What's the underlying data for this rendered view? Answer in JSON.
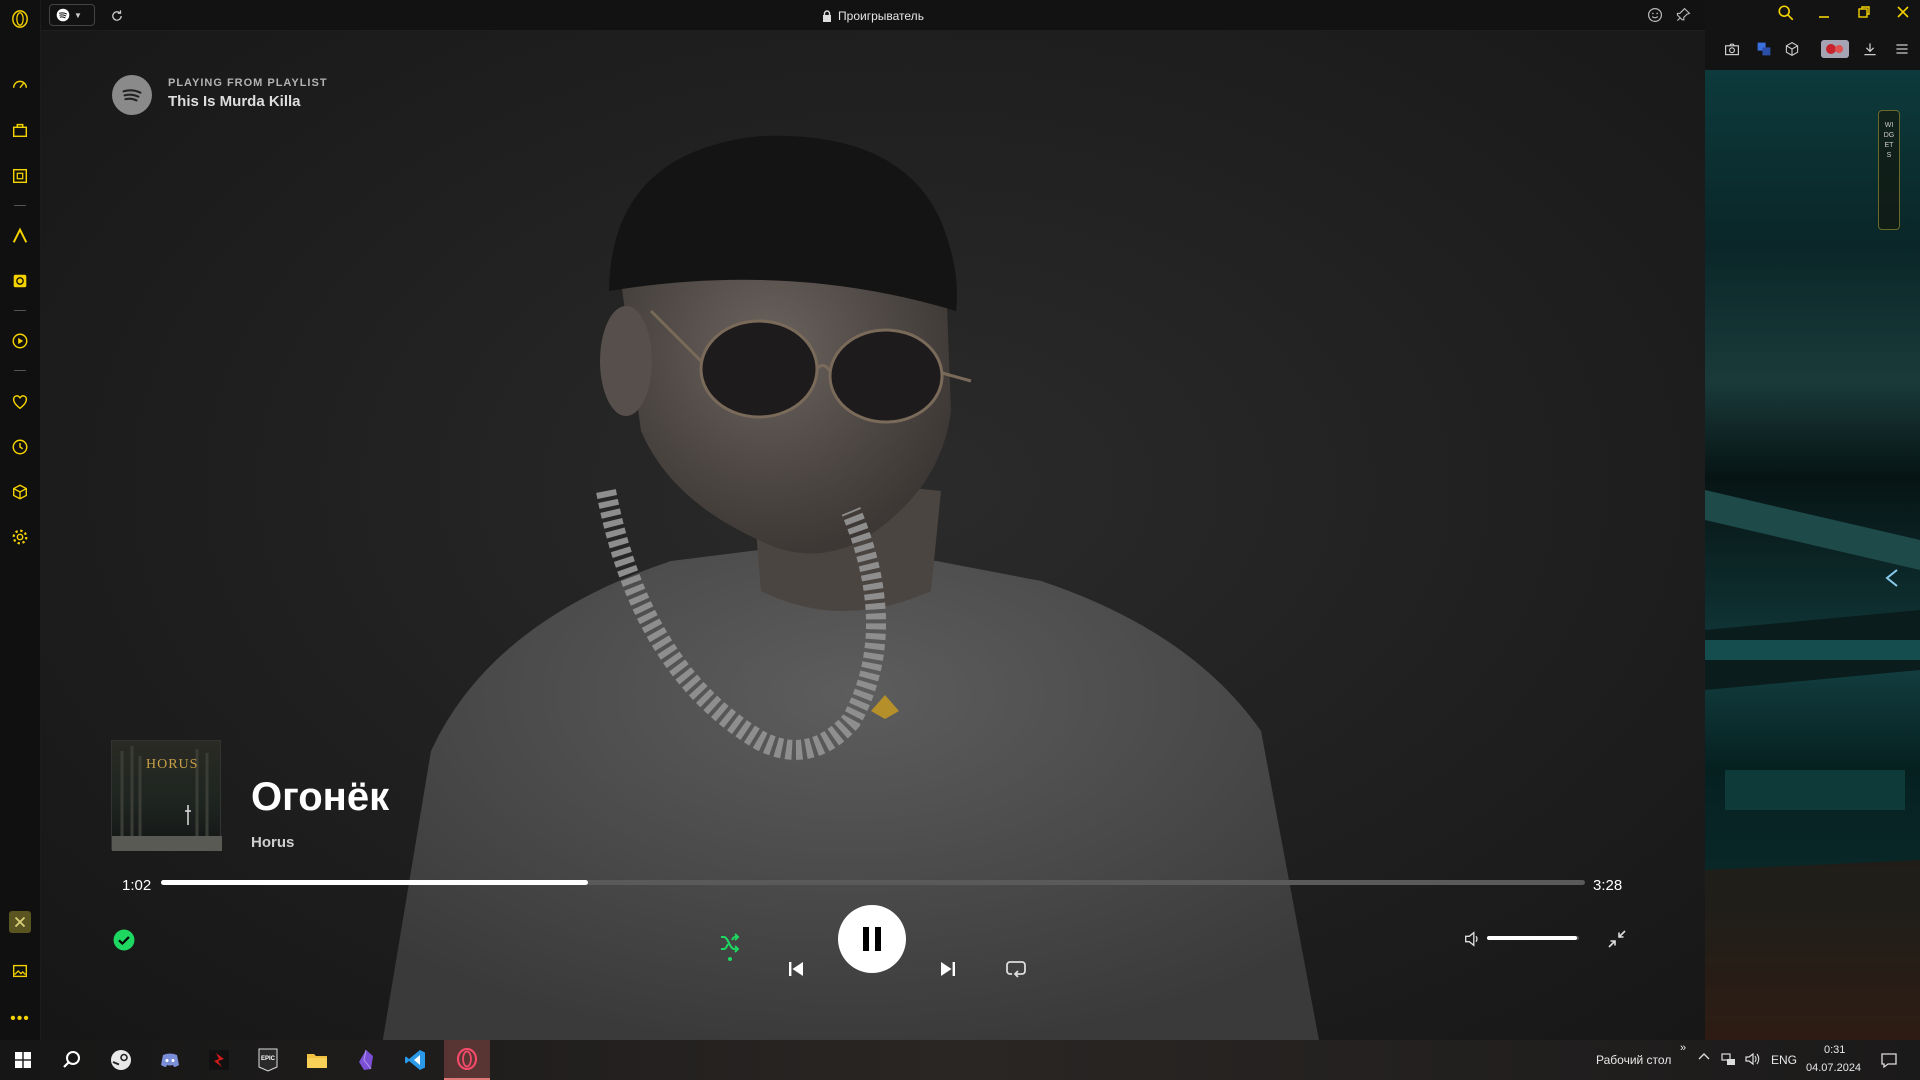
{
  "window": {
    "address_title": "Проигрыватель",
    "tab_icon": "spotify-icon"
  },
  "header": {
    "label": "PLAYING FROM PLAYLIST",
    "playlist": "This Is Murda Killa"
  },
  "track": {
    "title": "Огонёк",
    "artist": "Horus",
    "album_art_text": "HORUS",
    "current_time": "1:02",
    "duration": "3:28",
    "progress": 0.3,
    "liked": true,
    "shuffle_active": true,
    "is_playing": true
  },
  "volume": {
    "level": 0.98
  },
  "sidebar": {
    "items": [
      "speed-dial-icon",
      "bag-icon",
      "workspace-icon",
      "aria-icon",
      "widget-icon",
      "player-icon",
      "heart-icon",
      "history-icon",
      "box-icon",
      "settings-icon",
      "game-icon",
      "gallery-icon",
      "more-icon"
    ]
  },
  "right_panel": {
    "widgets_label": "WIDGETS"
  },
  "taskbar": {
    "apps": [
      "windows-start-icon",
      "search-icon",
      "steam-icon",
      "discord-icon",
      "app-red-icon",
      "epic-games-icon",
      "file-explorer-icon",
      "obsidian-icon",
      "vscode-icon",
      "opera-gx-icon"
    ],
    "desktop_label": "Рабочий стол",
    "lang": "ENG",
    "time": "0:31",
    "date": "04.07.2024"
  },
  "colors": {
    "accent_green": "#1ed760",
    "opera_yellow": "#f5d300"
  }
}
